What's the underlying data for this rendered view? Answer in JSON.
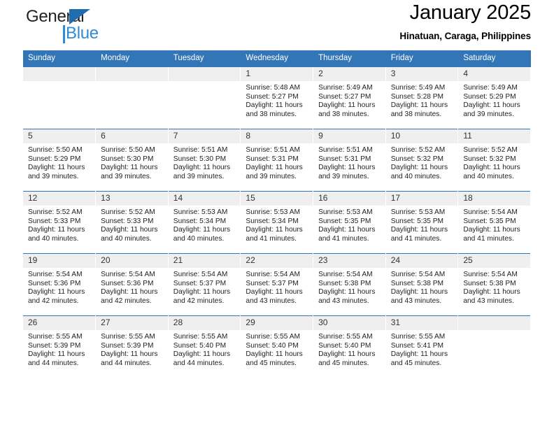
{
  "logo": {
    "word1": "General",
    "word2": "Blue",
    "accent_color": "#2e8bd8",
    "triangle_color": "#1f6cb0"
  },
  "header": {
    "title": "January 2025",
    "subtitle": "Hinatuan, Caraga, Philippines",
    "header_bg": "#3276b8",
    "daynum_bg": "#efefef"
  },
  "weekday_headers": [
    "Sunday",
    "Monday",
    "Tuesday",
    "Wednesday",
    "Thursday",
    "Friday",
    "Saturday"
  ],
  "labels": {
    "sunrise": "Sunrise:",
    "sunset": "Sunset:",
    "daylight": "Daylight:"
  },
  "weeks": [
    [
      {
        "day": "",
        "blank": true
      },
      {
        "day": "",
        "blank": true
      },
      {
        "day": "",
        "blank": true
      },
      {
        "day": "1",
        "sunrise": "Sunrise: 5:48 AM",
        "sunset": "Sunset: 5:27 PM",
        "daylight": "Daylight: 11 hours and 38 minutes."
      },
      {
        "day": "2",
        "sunrise": "Sunrise: 5:49 AM",
        "sunset": "Sunset: 5:27 PM",
        "daylight": "Daylight: 11 hours and 38 minutes."
      },
      {
        "day": "3",
        "sunrise": "Sunrise: 5:49 AM",
        "sunset": "Sunset: 5:28 PM",
        "daylight": "Daylight: 11 hours and 38 minutes."
      },
      {
        "day": "4",
        "sunrise": "Sunrise: 5:49 AM",
        "sunset": "Sunset: 5:29 PM",
        "daylight": "Daylight: 11 hours and 39 minutes."
      }
    ],
    [
      {
        "day": "5",
        "sunrise": "Sunrise: 5:50 AM",
        "sunset": "Sunset: 5:29 PM",
        "daylight": "Daylight: 11 hours and 39 minutes."
      },
      {
        "day": "6",
        "sunrise": "Sunrise: 5:50 AM",
        "sunset": "Sunset: 5:30 PM",
        "daylight": "Daylight: 11 hours and 39 minutes."
      },
      {
        "day": "7",
        "sunrise": "Sunrise: 5:51 AM",
        "sunset": "Sunset: 5:30 PM",
        "daylight": "Daylight: 11 hours and 39 minutes."
      },
      {
        "day": "8",
        "sunrise": "Sunrise: 5:51 AM",
        "sunset": "Sunset: 5:31 PM",
        "daylight": "Daylight: 11 hours and 39 minutes."
      },
      {
        "day": "9",
        "sunrise": "Sunrise: 5:51 AM",
        "sunset": "Sunset: 5:31 PM",
        "daylight": "Daylight: 11 hours and 39 minutes."
      },
      {
        "day": "10",
        "sunrise": "Sunrise: 5:52 AM",
        "sunset": "Sunset: 5:32 PM",
        "daylight": "Daylight: 11 hours and 40 minutes."
      },
      {
        "day": "11",
        "sunrise": "Sunrise: 5:52 AM",
        "sunset": "Sunset: 5:32 PM",
        "daylight": "Daylight: 11 hours and 40 minutes."
      }
    ],
    [
      {
        "day": "12",
        "sunrise": "Sunrise: 5:52 AM",
        "sunset": "Sunset: 5:33 PM",
        "daylight": "Daylight: 11 hours and 40 minutes."
      },
      {
        "day": "13",
        "sunrise": "Sunrise: 5:52 AM",
        "sunset": "Sunset: 5:33 PM",
        "daylight": "Daylight: 11 hours and 40 minutes."
      },
      {
        "day": "14",
        "sunrise": "Sunrise: 5:53 AM",
        "sunset": "Sunset: 5:34 PM",
        "daylight": "Daylight: 11 hours and 40 minutes."
      },
      {
        "day": "15",
        "sunrise": "Sunrise: 5:53 AM",
        "sunset": "Sunset: 5:34 PM",
        "daylight": "Daylight: 11 hours and 41 minutes."
      },
      {
        "day": "16",
        "sunrise": "Sunrise: 5:53 AM",
        "sunset": "Sunset: 5:35 PM",
        "daylight": "Daylight: 11 hours and 41 minutes."
      },
      {
        "day": "17",
        "sunrise": "Sunrise: 5:53 AM",
        "sunset": "Sunset: 5:35 PM",
        "daylight": "Daylight: 11 hours and 41 minutes."
      },
      {
        "day": "18",
        "sunrise": "Sunrise: 5:54 AM",
        "sunset": "Sunset: 5:35 PM",
        "daylight": "Daylight: 11 hours and 41 minutes."
      }
    ],
    [
      {
        "day": "19",
        "sunrise": "Sunrise: 5:54 AM",
        "sunset": "Sunset: 5:36 PM",
        "daylight": "Daylight: 11 hours and 42 minutes."
      },
      {
        "day": "20",
        "sunrise": "Sunrise: 5:54 AM",
        "sunset": "Sunset: 5:36 PM",
        "daylight": "Daylight: 11 hours and 42 minutes."
      },
      {
        "day": "21",
        "sunrise": "Sunrise: 5:54 AM",
        "sunset": "Sunset: 5:37 PM",
        "daylight": "Daylight: 11 hours and 42 minutes."
      },
      {
        "day": "22",
        "sunrise": "Sunrise: 5:54 AM",
        "sunset": "Sunset: 5:37 PM",
        "daylight": "Daylight: 11 hours and 43 minutes."
      },
      {
        "day": "23",
        "sunrise": "Sunrise: 5:54 AM",
        "sunset": "Sunset: 5:38 PM",
        "daylight": "Daylight: 11 hours and 43 minutes."
      },
      {
        "day": "24",
        "sunrise": "Sunrise: 5:54 AM",
        "sunset": "Sunset: 5:38 PM",
        "daylight": "Daylight: 11 hours and 43 minutes."
      },
      {
        "day": "25",
        "sunrise": "Sunrise: 5:54 AM",
        "sunset": "Sunset: 5:38 PM",
        "daylight": "Daylight: 11 hours and 43 minutes."
      }
    ],
    [
      {
        "day": "26",
        "sunrise": "Sunrise: 5:55 AM",
        "sunset": "Sunset: 5:39 PM",
        "daylight": "Daylight: 11 hours and 44 minutes."
      },
      {
        "day": "27",
        "sunrise": "Sunrise: 5:55 AM",
        "sunset": "Sunset: 5:39 PM",
        "daylight": "Daylight: 11 hours and 44 minutes."
      },
      {
        "day": "28",
        "sunrise": "Sunrise: 5:55 AM",
        "sunset": "Sunset: 5:40 PM",
        "daylight": "Daylight: 11 hours and 44 minutes."
      },
      {
        "day": "29",
        "sunrise": "Sunrise: 5:55 AM",
        "sunset": "Sunset: 5:40 PM",
        "daylight": "Daylight: 11 hours and 45 minutes."
      },
      {
        "day": "30",
        "sunrise": "Sunrise: 5:55 AM",
        "sunset": "Sunset: 5:40 PM",
        "daylight": "Daylight: 11 hours and 45 minutes."
      },
      {
        "day": "31",
        "sunrise": "Sunrise: 5:55 AM",
        "sunset": "Sunset: 5:41 PM",
        "daylight": "Daylight: 11 hours and 45 minutes."
      },
      {
        "day": "",
        "blank": true
      }
    ]
  ]
}
